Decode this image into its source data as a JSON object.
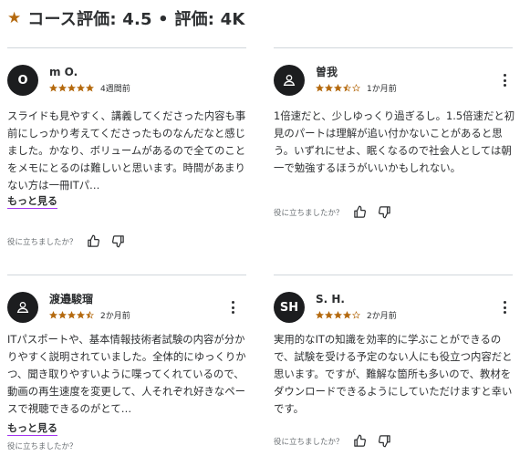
{
  "header": {
    "title": "コース評価: 4.5 • 評価: 4K",
    "icon": "star-icon",
    "accent": "#b4690e"
  },
  "reviews": [
    {
      "avatar": "O",
      "name": "m O.",
      "rating": 5,
      "time": "4週間前",
      "text": "スライドも見やすく、講義してくださった内容も事前にしっかり考えてくださったものなんだなと感じました。かなり、ボリュームがあるので全てのことをメモにとるのは難しいと思います。時間があまりない方は一冊ITパ…",
      "more": "もっと見る",
      "helpful": "役に立ちましたか？"
    },
    {
      "avatar": "person-icon",
      "name": "曽我",
      "rating": 3.5,
      "time": "1か月前",
      "text": "1倍速だと、少しゆっくり過ぎるし。1.5倍速だと初見のパートは理解が追い付かないことがあると思う。いずれにせよ、眠くなるので社会人としては朝一で勉強するほうがいいかもしれない。",
      "helpful": "役に立ちましたか？"
    },
    {
      "avatar": "person-icon",
      "name": "渡邉駿瑠",
      "rating": 4.5,
      "time": "2か月前",
      "text": "ITパスポートや、基本情報技術者試験の内容が分かりやすく説明されていました。全体的にゆっくりかつ、聞き取りやすいように喋ってくれているので、動画の再生速度を変更して、人それぞれ好きなペースで視聴できるのがとて…",
      "more": "もっと見る",
      "helpful": "役に立ちましたか？"
    },
    {
      "avatar": "SH",
      "name": "S. H.",
      "rating": 4,
      "time": "2か月前",
      "text": "実用的なITの知識を効率的に学ぶことができるので、試験を受ける予定のない人にも役立つ内容だと思います。ですが、難解な箇所も多いので、教材をダウンロードできるようにしていただけますと幸いです。",
      "helpful": "役に立ちましたか？"
    }
  ],
  "colors": {
    "star": "#b4690e",
    "link_underline": "#a435f0",
    "avatar_bg": "#1c1d1f"
  }
}
